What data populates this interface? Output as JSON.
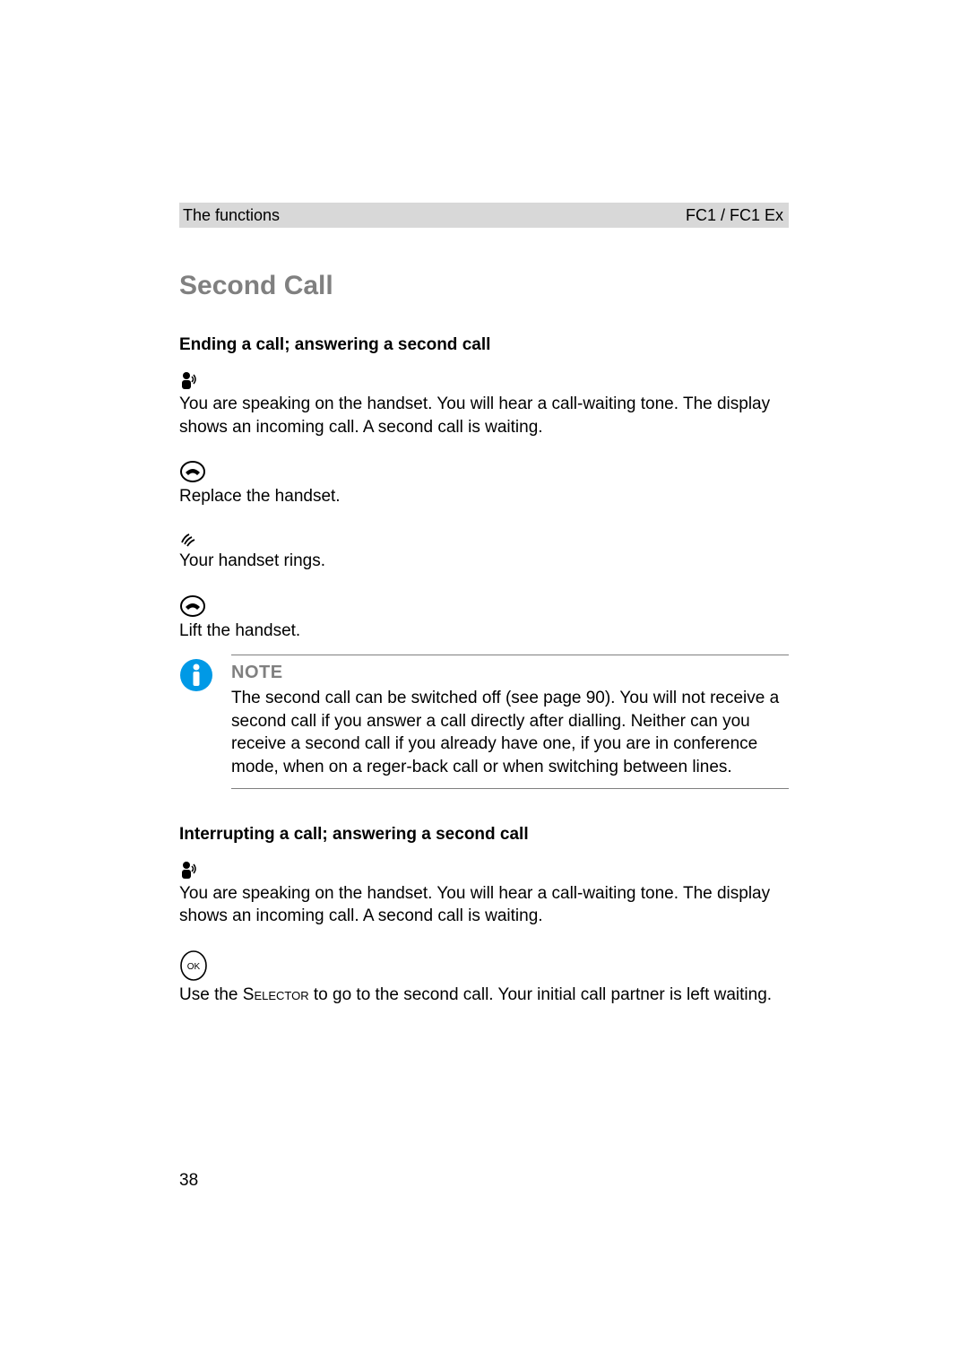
{
  "header": {
    "left": "The functions",
    "right": "FC1 / FC1 Ex"
  },
  "section_title": "Second Call",
  "sub1_title": "Ending a call; answering a second call",
  "sub1_text1": "You are speaking on the handset. You will hear a call-waiting tone. The display shows an incoming call. A second call is waiting.",
  "sub1_text2": "Replace the handset.",
  "sub1_text3": "Your handset rings.",
  "sub1_text4": "Lift the handset.",
  "note": {
    "label": "NOTE",
    "body": "The second call can be switched off (see page 90). You will not receive a second call if you answer a call directly after dialling. Neither can you receive a second call if you already have one, if you are in conference mode, when on a reger-back call or when switching between lines."
  },
  "sub2_title": "Interrupting a call; answering a second call",
  "sub2_text1": "You are speaking on the handset. You will hear a call-waiting tone. The display shows an incoming call. A second call is waiting.",
  "sub2_text2a": "Use the ",
  "sub2_text2_selector": "Selector",
  "sub2_text2b": " to go to the second call. Your initial call partner is left waiting.",
  "page_number": "38"
}
